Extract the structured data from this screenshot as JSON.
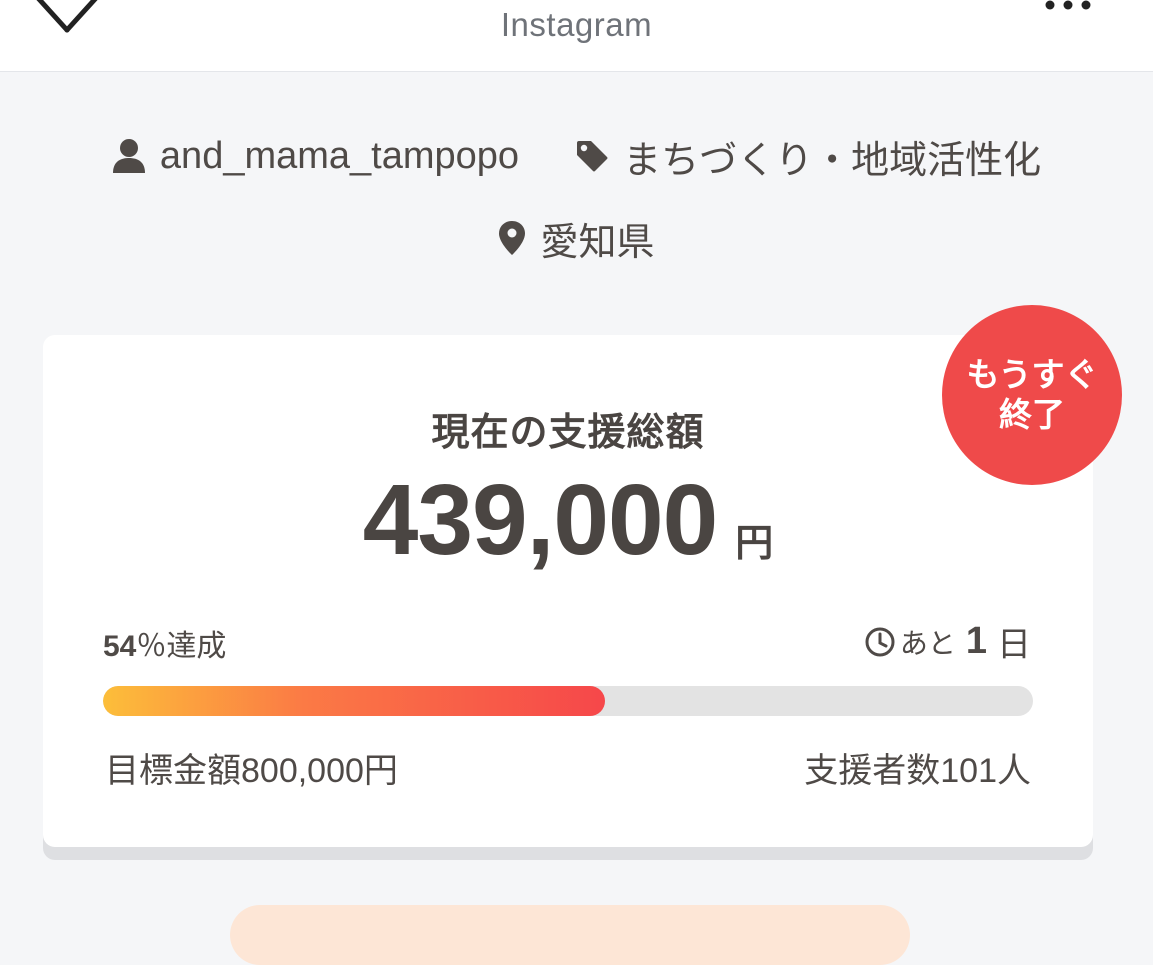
{
  "header": {
    "title": "Instagram"
  },
  "meta": {
    "username": "and_mama_tampopo",
    "category": "まちづくり・地域活性化",
    "location": "愛知県"
  },
  "funding": {
    "heading": "現在の支援総額",
    "amount": "439,000",
    "amount_unit": "円",
    "percent_value": "54",
    "percent_suffix": "％達成",
    "progress_fraction": 0.54,
    "remaining_prefix": "あと",
    "remaining_days": "1",
    "remaining_unit": "日",
    "goal": "目標金額800,000円",
    "supporters": "支援者数101人"
  },
  "badge": {
    "line1": "もうすぐ",
    "line2": "終了"
  },
  "colors": {
    "badge": "#ef4a4a",
    "progress_start": "#fcbe3a",
    "progress_end": "#f6474a",
    "text": "#4a4542",
    "background": "#f5f6f8"
  }
}
